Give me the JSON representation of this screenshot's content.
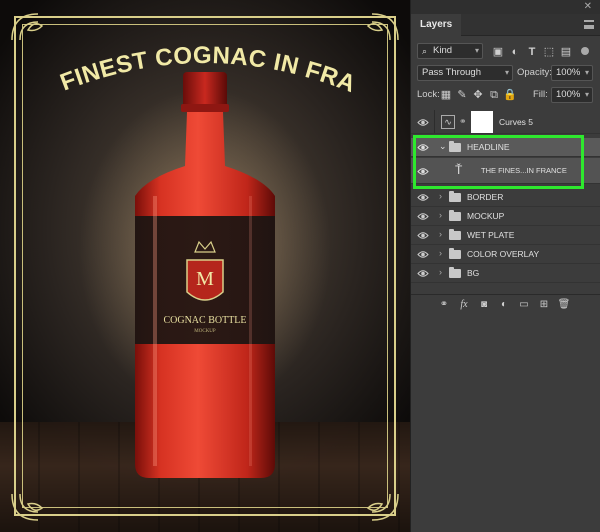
{
  "artwork": {
    "headline": "THE FINEST COGNAC IN FRANCE",
    "label_monogram": "M",
    "label_title": "COGNAC BOTTLE",
    "label_subtitle": "MOCKUP"
  },
  "panel": {
    "tab": "Layers",
    "close_glyph": "✕",
    "filter_kind": "Kind",
    "blend_mode": "Pass Through",
    "opacity_label": "Opacity:",
    "opacity_value": "100%",
    "lock_label": "Lock:",
    "fill_label": "Fill:",
    "fill_value": "100%"
  },
  "layers": [
    {
      "name": "Curves 5",
      "type": "adjustment"
    },
    {
      "name": "HEADLINE",
      "type": "group",
      "expanded": true,
      "selected": true
    },
    {
      "name": "THE FINES...IN FRANCE",
      "type": "text",
      "indent": true
    },
    {
      "name": "BORDER",
      "type": "group"
    },
    {
      "name": "MOCKUP",
      "type": "group"
    },
    {
      "name": "WET PLATE",
      "type": "group"
    },
    {
      "name": "COLOR OVERLAY",
      "type": "group"
    },
    {
      "name": "BG",
      "type": "group"
    }
  ],
  "colors": {
    "highlight": "#2ee82e",
    "frame_gold": "#d9cf8a",
    "headline_text": "#f1e9a6",
    "bottle_red": "#d82a1f"
  }
}
